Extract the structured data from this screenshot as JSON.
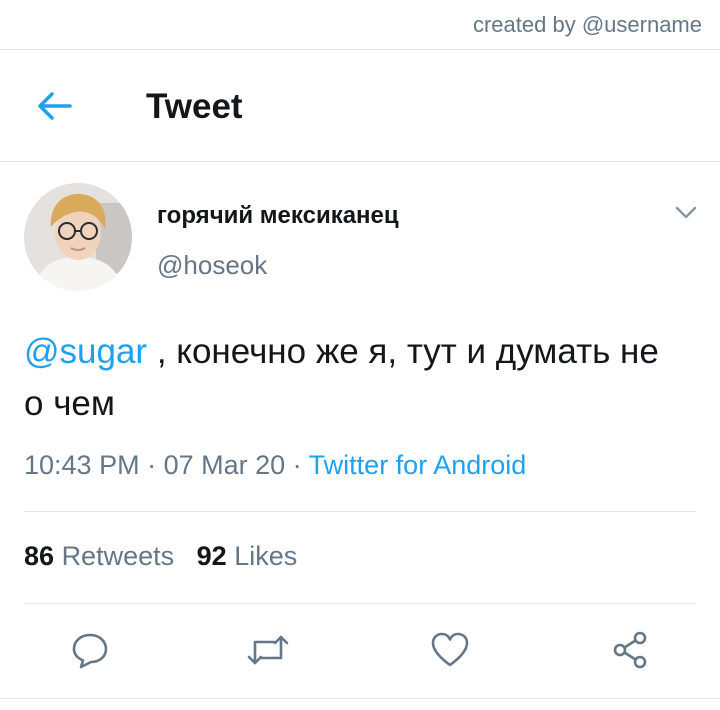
{
  "credit": "created by @username",
  "header": {
    "title": "Tweet",
    "back_icon": "arrow-left-icon"
  },
  "author": {
    "display_name": "горячий мексиканец",
    "handle": "@hoseok",
    "avatar": "user-avatar"
  },
  "tweet": {
    "mention": "@sugar",
    "text": " , конечно же я, тут и думать не о чем",
    "time": "10:43 PM",
    "sep1": " · ",
    "date": "07 Mar 20",
    "sep2": " · ",
    "source": "Twitter for Android"
  },
  "stats": {
    "retweets_count": "86",
    "retweets_label": "Retweets",
    "likes_count": "92",
    "likes_label": "Likes"
  },
  "actions": [
    "reply-icon",
    "retweet-icon",
    "like-icon",
    "share-icon"
  ],
  "colors": {
    "accent": "#1da1f2",
    "muted": "#657786",
    "text": "#14171a",
    "border": "#e1e8ed"
  }
}
